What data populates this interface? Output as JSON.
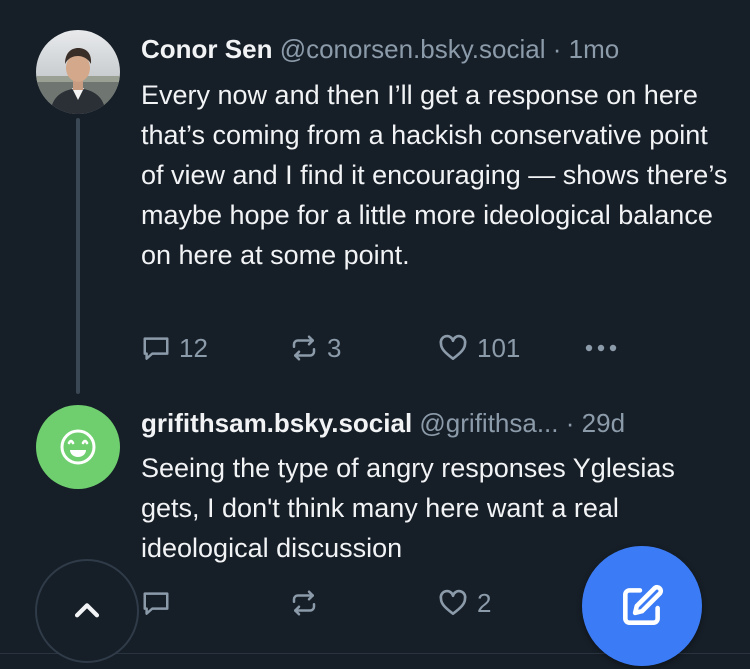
{
  "feed": {
    "posts": [
      {
        "author_name": "Conor Sen",
        "handle": "@conorsen.bsky.social",
        "separator": "·",
        "time": "1mo",
        "text": "Every now and then I’ll get a response on here that’s coming from a hackish conservative point of view and I find it encouraging — shows there’s maybe hope for a little more ideological balance on here at some point.",
        "reply_count": "12",
        "repost_count": "3",
        "like_count": "101"
      },
      {
        "author_name": "grifithsam.bsky.social",
        "handle": "@grifithsa...",
        "separator": "·",
        "time": "29d",
        "text": "Seeing the type of angry responses Yglesias gets, I don't think many here want a real ideological discussion",
        "reply_count": "",
        "repost_count": "",
        "like_count": "2",
        "avatar_color": "#6fcf6f"
      }
    ]
  },
  "icons": {
    "reply": "speech-bubble-icon",
    "repost": "repost-arrows-icon",
    "like": "heart-icon",
    "more": "more-dots-icon",
    "scroll_top": "chevron-up-icon",
    "compose": "compose-icon",
    "default_avatar": "smiley-icon"
  },
  "colors": {
    "background": "#161e27",
    "muted_text": "#8c9baa",
    "accent": "#3b7cf6"
  }
}
